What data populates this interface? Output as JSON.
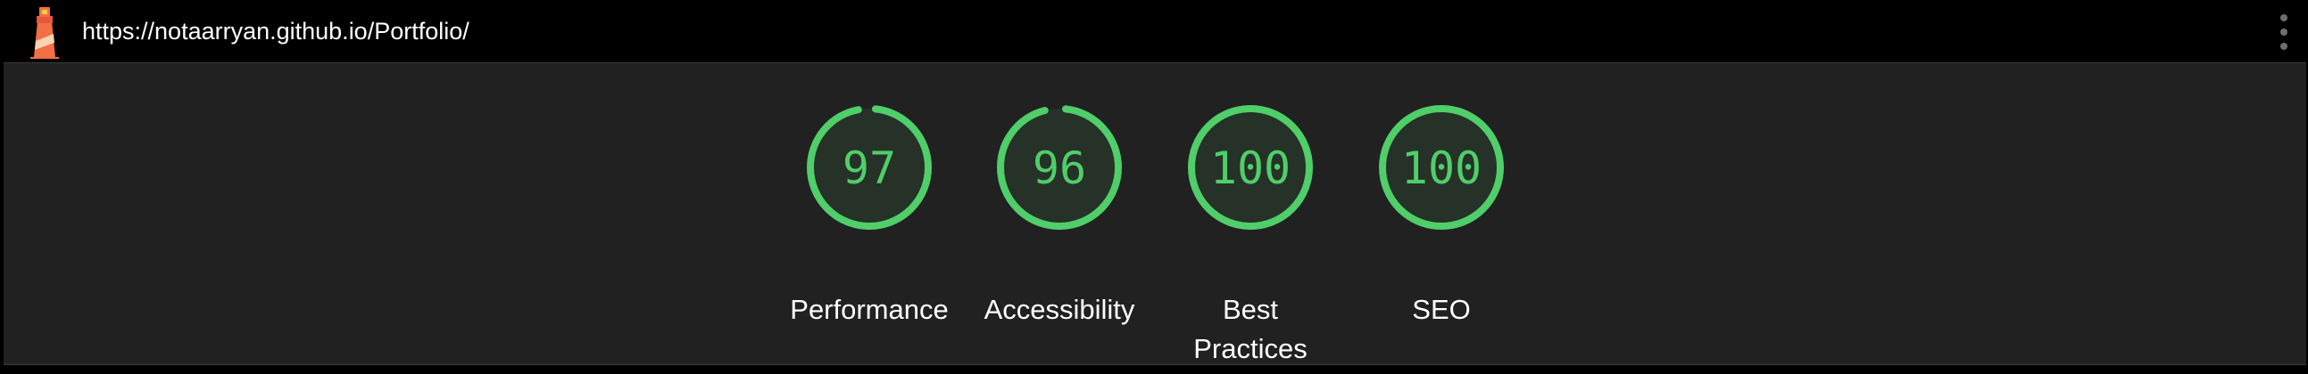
{
  "header": {
    "url": "https://notaarryan.github.io/Portfolio/",
    "logo_icon": "lighthouse-icon",
    "menu_icon": "vertical-ellipsis-icon"
  },
  "colors": {
    "pass_green": "#4fce6a",
    "gauge_fill": "#263127",
    "panel_bg": "#212121"
  },
  "scores": [
    {
      "id": "performance",
      "value": "97",
      "fraction": 0.97,
      "label": "Performance"
    },
    {
      "id": "accessibility",
      "value": "96",
      "fraction": 0.96,
      "label": "Accessibility"
    },
    {
      "id": "best-practices",
      "value": "100",
      "fraction": 1.0,
      "label": "Best Practices"
    },
    {
      "id": "seo",
      "value": "100",
      "fraction": 1.0,
      "label": "SEO"
    }
  ]
}
